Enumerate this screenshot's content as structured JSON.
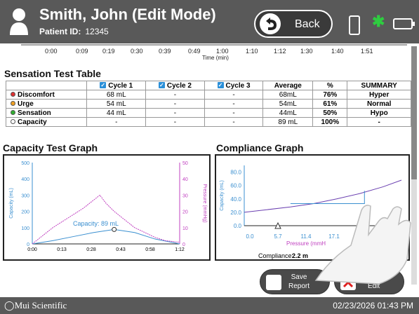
{
  "header": {
    "patient_name": "Smith, John (Edit Mode)",
    "patient_id_label": "Patient ID:",
    "patient_id": "12345",
    "back_label": "Back"
  },
  "time_axis": {
    "ticks": [
      "0:00",
      "0:09",
      "0:19",
      "0:30",
      "0:39",
      "0:49",
      "1:00",
      "1:10",
      "1:12",
      "1:30",
      "1:40",
      "1:51"
    ],
    "label": "Time (min)"
  },
  "sensation": {
    "title": "Sensation Test Table",
    "headers": [
      "",
      "Cycle 1",
      "Cycle 2",
      "Cycle 3",
      "Average",
      "%",
      "SUMMARY"
    ],
    "rows": [
      {
        "name": "Discomfort",
        "color": "#e03030",
        "c1": "68 mL",
        "c2": "-",
        "c3": "-",
        "avg": "68mL",
        "pct": "76%",
        "summary": "Hyper"
      },
      {
        "name": "Urge",
        "color": "#f0a020",
        "c1": "54 mL",
        "c2": "-",
        "c3": "-",
        "avg": "54mL",
        "pct": "61%",
        "summary": "Normal"
      },
      {
        "name": "Sensation",
        "color": "#30b030",
        "c1": "44 mL",
        "c2": "-",
        "c3": "-",
        "avg": "44mL",
        "pct": "50%",
        "summary": "Hypo"
      },
      {
        "name": "Capacity",
        "color": "#ffffff",
        "c1": "-",
        "c2": "-",
        "c3": "-",
        "avg": "89 mL",
        "pct": "100%",
        "summary": "-"
      }
    ]
  },
  "capacity_graph": {
    "title": "Capacity Test Graph",
    "annotation": "Capacity: 89 mL"
  },
  "compliance_graph": {
    "title": "Compliance Graph",
    "compliance_label": "Compliance:",
    "compliance_value": "2.2 m"
  },
  "chart_data": [
    {
      "type": "line",
      "title": "Capacity Test Graph",
      "xlabel": "",
      "ylabel": "Capacity (mL)",
      "y2label": "Pressure (mmHg)",
      "x_ticks": [
        "0:00",
        "0:13",
        "0:28",
        "0:43",
        "0:58",
        "1:12"
      ],
      "ylim": [
        0,
        500
      ],
      "y2lim": [
        0,
        50
      ],
      "y_ticks": [
        "0",
        "100",
        "200",
        "300",
        "400",
        "500"
      ],
      "y2_ticks": [
        "0",
        "10",
        "20",
        "30",
        "40",
        "50"
      ],
      "series": [
        {
          "axis": "left",
          "color": "#3a8fd0",
          "x": [
            0,
            10,
            20,
            30,
            40,
            50,
            60,
            72
          ],
          "y": [
            0,
            20,
            45,
            70,
            89,
            70,
            30,
            0
          ]
        },
        {
          "axis": "right",
          "color": "#c040c0",
          "x": [
            0,
            5,
            10,
            15,
            20,
            25,
            30,
            33,
            36,
            40,
            45,
            50,
            55,
            60,
            65,
            72
          ],
          "y": [
            0,
            5,
            10,
            14,
            18,
            22,
            27,
            30,
            25,
            20,
            15,
            10,
            7,
            4,
            2,
            1
          ]
        }
      ]
    },
    {
      "type": "line",
      "title": "Compliance Graph",
      "xlabel": "Pressure (mmH",
      "ylabel": "Capacity (mL)",
      "x_ticks": [
        "0.0",
        "5.7",
        "11.4",
        "17.1"
      ],
      "y_ticks": [
        "0.0",
        "20.0",
        "40.0",
        "60.0",
        "80.0"
      ],
      "ylim": [
        0,
        90
      ],
      "series": [
        {
          "color": "#6a3fb0",
          "x": [
            0,
            5,
            10,
            15,
            20,
            25,
            30,
            34
          ],
          "y": [
            20,
            24,
            28,
            33,
            40,
            48,
            58,
            68
          ]
        }
      ]
    }
  ],
  "buttons": {
    "save": "Save\nReport",
    "cancel": "Cancel\nEdit"
  },
  "footer": {
    "brand": "Mui Scientific",
    "datetime": "02/23/2026 01:43 PM"
  }
}
